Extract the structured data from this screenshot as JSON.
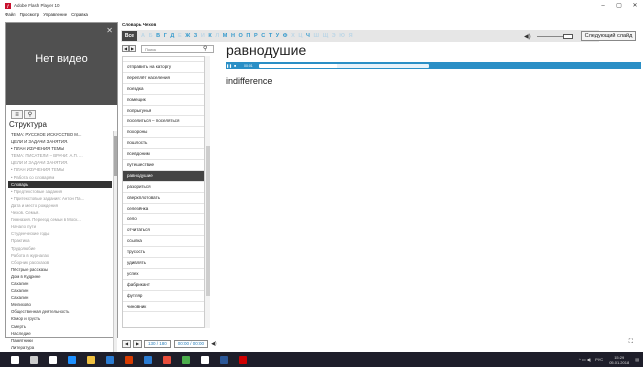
{
  "window": {
    "title": "Adobe Flash Player 10",
    "minimize": "–",
    "maximize": "▢",
    "close": "✕"
  },
  "menu": [
    "Файл",
    "Просмотр",
    "Управление",
    "Справка"
  ],
  "video": {
    "label": "Нет видео",
    "close": "✕"
  },
  "structure": {
    "title": "Структура",
    "items": [
      {
        "label": "ТЕМА: РУССКОЕ ИСКУССТВО М...",
        "style": "dark"
      },
      {
        "label": "ЦЕЛИ И ЗАДАЧИ ЗАНЯТИЯ.",
        "style": "dark"
      },
      {
        "label": "• ПЛАН ИЗУЧЕНИЯ ТЕМЫ",
        "style": "dark"
      },
      {
        "label": "ТЕМА: ПИСАТЕЛИ – ВРАЧИ: А.П. ...",
        "style": "light"
      },
      {
        "label": "ЦЕЛИ И ЗАДАЧИ ЗАНЯТИЯ.",
        "style": "light"
      },
      {
        "label": "• ПЛАН ИЗУЧЕНИЯ ТЕМЫ",
        "style": "light"
      },
      {
        "label": "• Работа со словарём",
        "style": "light"
      },
      {
        "label": "Словарь",
        "style": "selected"
      },
      {
        "label": "• Предтекстовые задания",
        "style": "light"
      },
      {
        "label": "• Притекстовые задания: Антон Па...",
        "style": "light"
      },
      {
        "label": "Дата и место рождения",
        "style": "light"
      },
      {
        "label": "Чехов. Семья.",
        "style": "light"
      },
      {
        "label": "Гимназия. Переезд семьи в Моск...",
        "style": "light"
      },
      {
        "label": "Начало пути",
        "style": "light"
      },
      {
        "label": "Студенческие годы",
        "style": "light"
      },
      {
        "label": "Практика",
        "style": "light"
      },
      {
        "label": "Трудолюбие",
        "style": "light"
      },
      {
        "label": "Работа в журналах",
        "style": "light"
      },
      {
        "label": "Сборник рассказов",
        "style": "light"
      },
      {
        "label": "Пёстрые рассказы",
        "style": "dark"
      },
      {
        "label": "Дом в Кудрине",
        "style": "dark"
      },
      {
        "label": "Сахалин",
        "style": "dark"
      },
      {
        "label": "Сахалин",
        "style": "dark"
      },
      {
        "label": "Сахалин",
        "style": "dark"
      },
      {
        "label": "Мелихово",
        "style": "dark"
      },
      {
        "label": "Общественная деятельность",
        "style": "dark"
      },
      {
        "label": "Юмор и грусть",
        "style": "dark"
      },
      {
        "label": "Смерть",
        "style": "dark"
      },
      {
        "label": "Наследие",
        "style": "dark"
      },
      {
        "label": "Памятники",
        "style": "dark"
      },
      {
        "label": "Литература",
        "style": "dark"
      }
    ]
  },
  "dictionary": {
    "title": "Словарь Чехов",
    "all_label": "Все",
    "letters": [
      {
        "ch": "А",
        "active": false
      },
      {
        "ch": "Б",
        "active": false
      },
      {
        "ch": "В",
        "active": true
      },
      {
        "ch": "Г",
        "active": true
      },
      {
        "ch": "Д",
        "active": true
      },
      {
        "ch": "Е",
        "active": false
      },
      {
        "ch": "Ж",
        "active": true
      },
      {
        "ch": "З",
        "active": true
      },
      {
        "ch": "И",
        "active": false
      },
      {
        "ch": "К",
        "active": true
      },
      {
        "ch": "Л",
        "active": false
      },
      {
        "ch": "М",
        "active": true
      },
      {
        "ch": "Н",
        "active": true
      },
      {
        "ch": "О",
        "active": true
      },
      {
        "ch": "П",
        "active": true
      },
      {
        "ch": "Р",
        "active": true
      },
      {
        "ch": "С",
        "active": true
      },
      {
        "ch": "Т",
        "active": true
      },
      {
        "ch": "У",
        "active": true
      },
      {
        "ch": "Ф",
        "active": true
      },
      {
        "ch": "Х",
        "active": false
      },
      {
        "ch": "Ц",
        "active": false
      },
      {
        "ch": "Ч",
        "active": true
      },
      {
        "ch": "Ш",
        "active": false
      },
      {
        "ch": "Щ",
        "active": false
      },
      {
        "ch": "Э",
        "active": false
      },
      {
        "ch": "Ю",
        "active": false
      },
      {
        "ch": "Я",
        "active": false
      }
    ],
    "search_placeholder": "Поиск",
    "words": [
      {
        "label": "отправить на каторгу",
        "selected": false
      },
      {
        "label": "переплёт населения",
        "selected": false
      },
      {
        "label": "поездка",
        "selected": false
      },
      {
        "label": "помещик",
        "selected": false
      },
      {
        "label": "попрыгунья",
        "selected": false
      },
      {
        "label": "поселиться – поселяться",
        "selected": false
      },
      {
        "label": "похороны",
        "selected": false
      },
      {
        "label": "пошлость",
        "selected": false
      },
      {
        "label": "псевдоним",
        "selected": false
      },
      {
        "label": "путешествие",
        "selected": false
      },
      {
        "label": "равнодушие",
        "selected": true
      },
      {
        "label": "разориться",
        "selected": false
      },
      {
        "label": "сверхплотовать",
        "selected": false
      },
      {
        "label": "селезёнка",
        "selected": false
      },
      {
        "label": "село",
        "selected": false
      },
      {
        "label": "отчитаться",
        "selected": false
      },
      {
        "label": "ссылка",
        "selected": false
      },
      {
        "label": "трусость",
        "selected": false
      },
      {
        "label": "удивлять",
        "selected": false
      },
      {
        "label": "успех",
        "selected": false
      },
      {
        "label": "фабрикант",
        "selected": false
      },
      {
        "label": "футляр",
        "selected": false
      },
      {
        "label": "чиновник",
        "selected": false
      }
    ]
  },
  "entry": {
    "headword": "равнодушие",
    "translation": "indifference",
    "audio_time": "00:01",
    "audio_progress": 0.46
  },
  "controls": {
    "next_slide": "Следующий слайд",
    "volume_icon": "speaker-icon",
    "slide_counter": "130 / 180",
    "time_counter": "00:00 / 00:00"
  },
  "taskbar": {
    "time": "15:29",
    "date": "05.01.2018",
    "lang": "РУС",
    "icon_colors": [
      "#ffffff",
      "#cccccc",
      "#ffffff",
      "#1e90ff",
      "#f0c040",
      "#2b7cd3",
      "#d83b01",
      "#2b7cd3",
      "#e94e3c",
      "#4cae4c",
      "#ffffff",
      "#2b5797",
      "#d00000"
    ]
  },
  "colors": {
    "accent": "#2a8fc6",
    "selected_bg": "#444444"
  }
}
